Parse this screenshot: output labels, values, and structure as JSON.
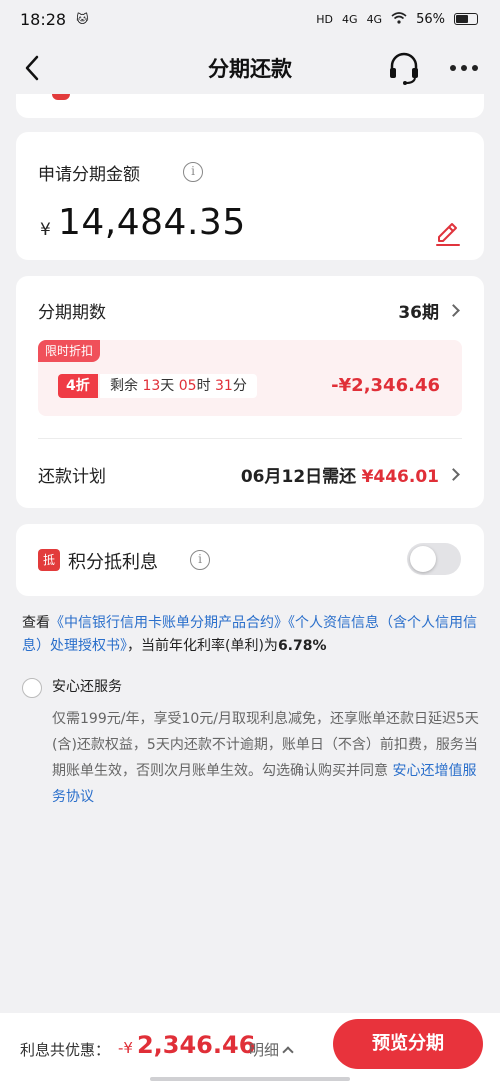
{
  "status": {
    "time": "18:28",
    "battery": "56%",
    "net1": "4G",
    "net2": "4G",
    "hd": "HD"
  },
  "nav": {
    "title": "分期还款"
  },
  "amount": {
    "label": "申请分期金额",
    "currency": "¥",
    "value": "14,484.35"
  },
  "plan": {
    "periods_label": "分期期数",
    "periods_value": "36期",
    "promo_tag": "限时折扣",
    "discount": "4折",
    "remain_prefix": "剩余",
    "days": "13",
    "days_unit": "天",
    "hours": "05",
    "hours_unit": "时",
    "minutes": "31",
    "minutes_unit": "分",
    "promo_value": "-¥2,346.46",
    "schedule_label": "还款计划",
    "schedule_date": "06月12日需还",
    "schedule_amount": "¥446.01"
  },
  "points": {
    "badge": "抵",
    "label": "积分抵利息",
    "enabled": false
  },
  "agreement": {
    "prefix": "查看",
    "link1": "《中信银行信用卡账单分期产品合约》",
    "link2": "《个人资信信息（含个人信用信息）处理授权书》",
    "rate_text": "，当前年化利率(单利)为",
    "rate": "6.78%"
  },
  "service": {
    "title": "安心还服务",
    "desc": "仅需199元/年，享受10元/月取现利息减免，还享账单还款日延迟5天(含)还款权益，5天内还款不计逾期，账单日（不含）前扣费，服务当期账单生效，否则次月账单生效。勾选确认购买并同意",
    "link": "安心还增值服务协议"
  },
  "bottom": {
    "label": "利息共优惠：",
    "prefix": "-¥",
    "value": "2,346.46",
    "detail": "明细",
    "cta": "预览分期"
  }
}
